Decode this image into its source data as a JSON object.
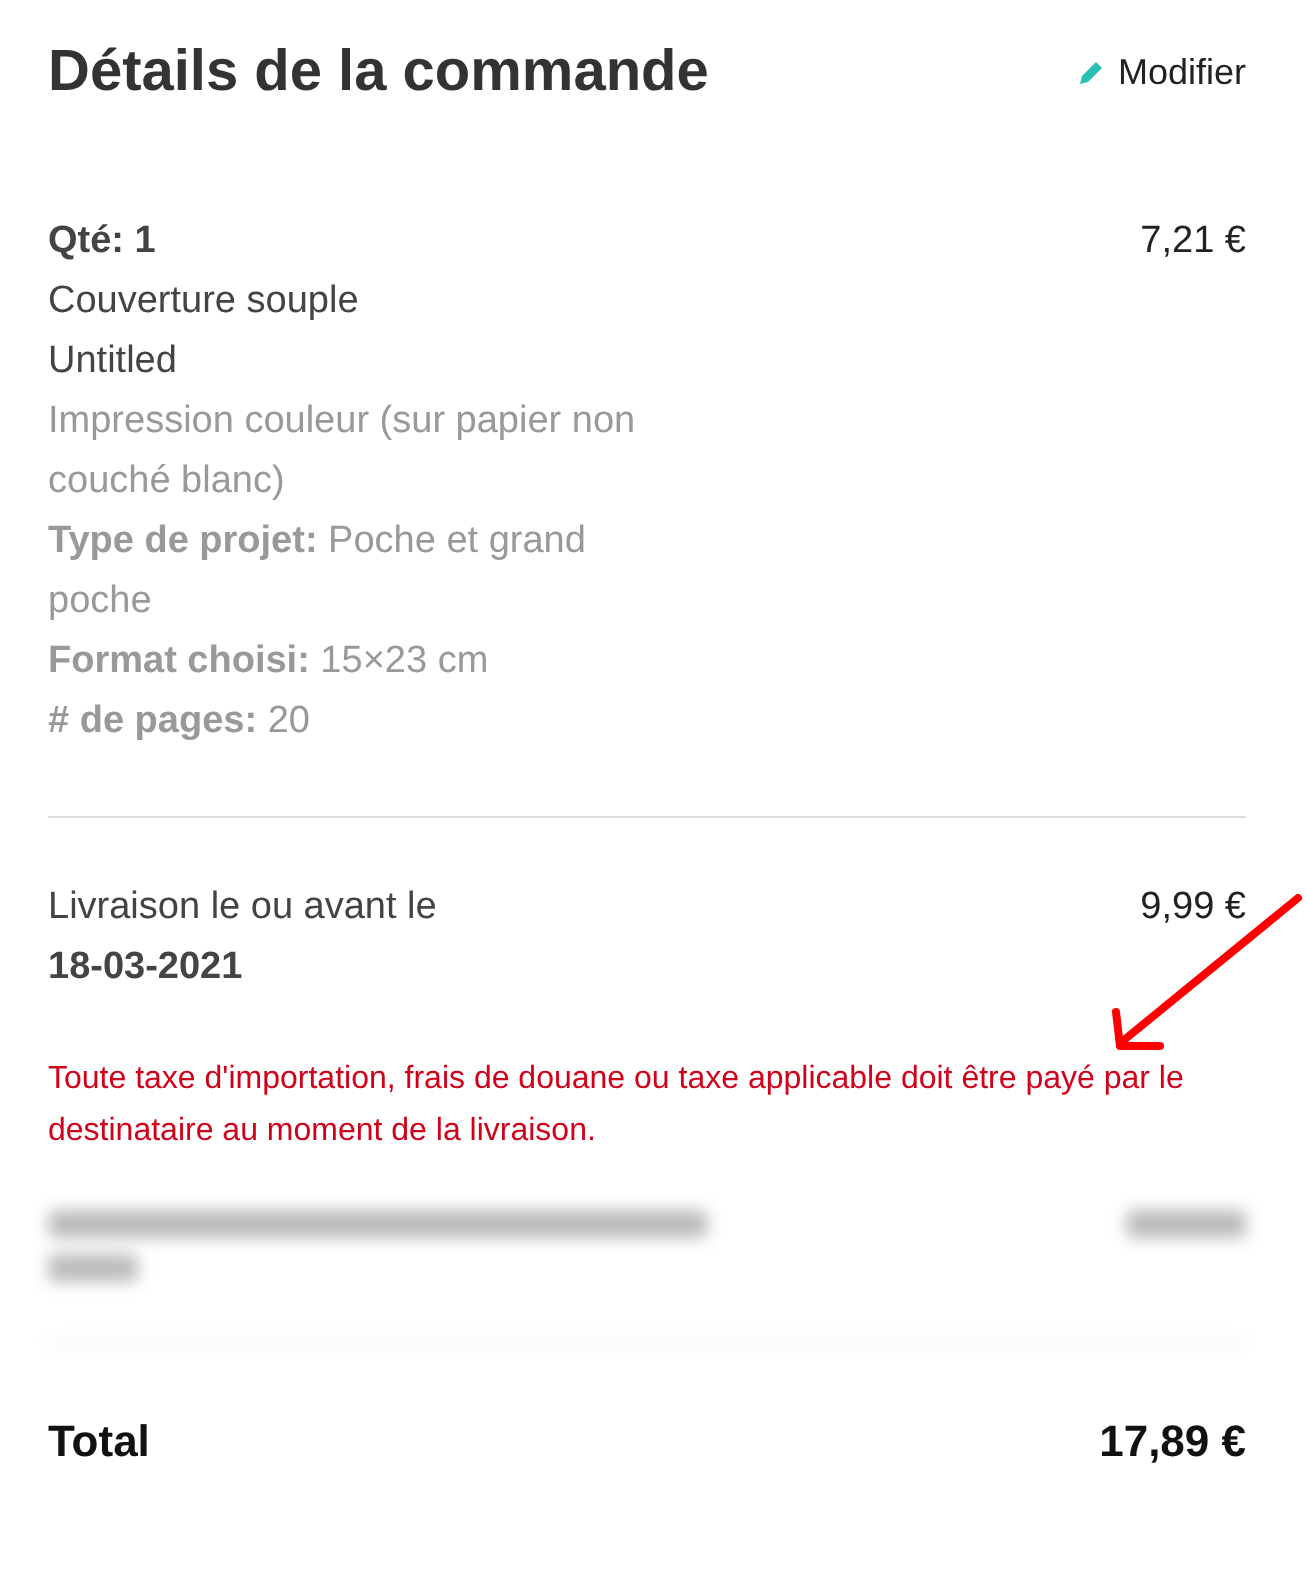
{
  "header": {
    "title": "Détails de la commande",
    "edit_link": "Modifier"
  },
  "item": {
    "price": "7,21 €",
    "lines": [
      {
        "kind": "bold",
        "text": "Qté: 1"
      },
      {
        "kind": "plain",
        "text": "Couverture souple"
      },
      {
        "kind": "plain",
        "text": "Untitled"
      },
      {
        "kind": "muted",
        "text": "Impression couleur (sur papier non couché blanc)"
      },
      {
        "kind": "muted",
        "text": "**Type de projet:** Poche et grand poche"
      },
      {
        "kind": "muted",
        "text": "**Format choisi:** 15×23 cm"
      },
      {
        "kind": "muted",
        "text": "**# de pages:** 20"
      }
    ]
  },
  "delivery": {
    "label": "Livraison le ou avant le",
    "date": "18-03-2021",
    "price": "9,99 €",
    "notice": "Toute taxe d'importation, frais de douane ou taxe applicable doit être payé par le destinataire au moment de la livraison."
  },
  "total": {
    "label": "Total",
    "amount": "17,89 €"
  }
}
